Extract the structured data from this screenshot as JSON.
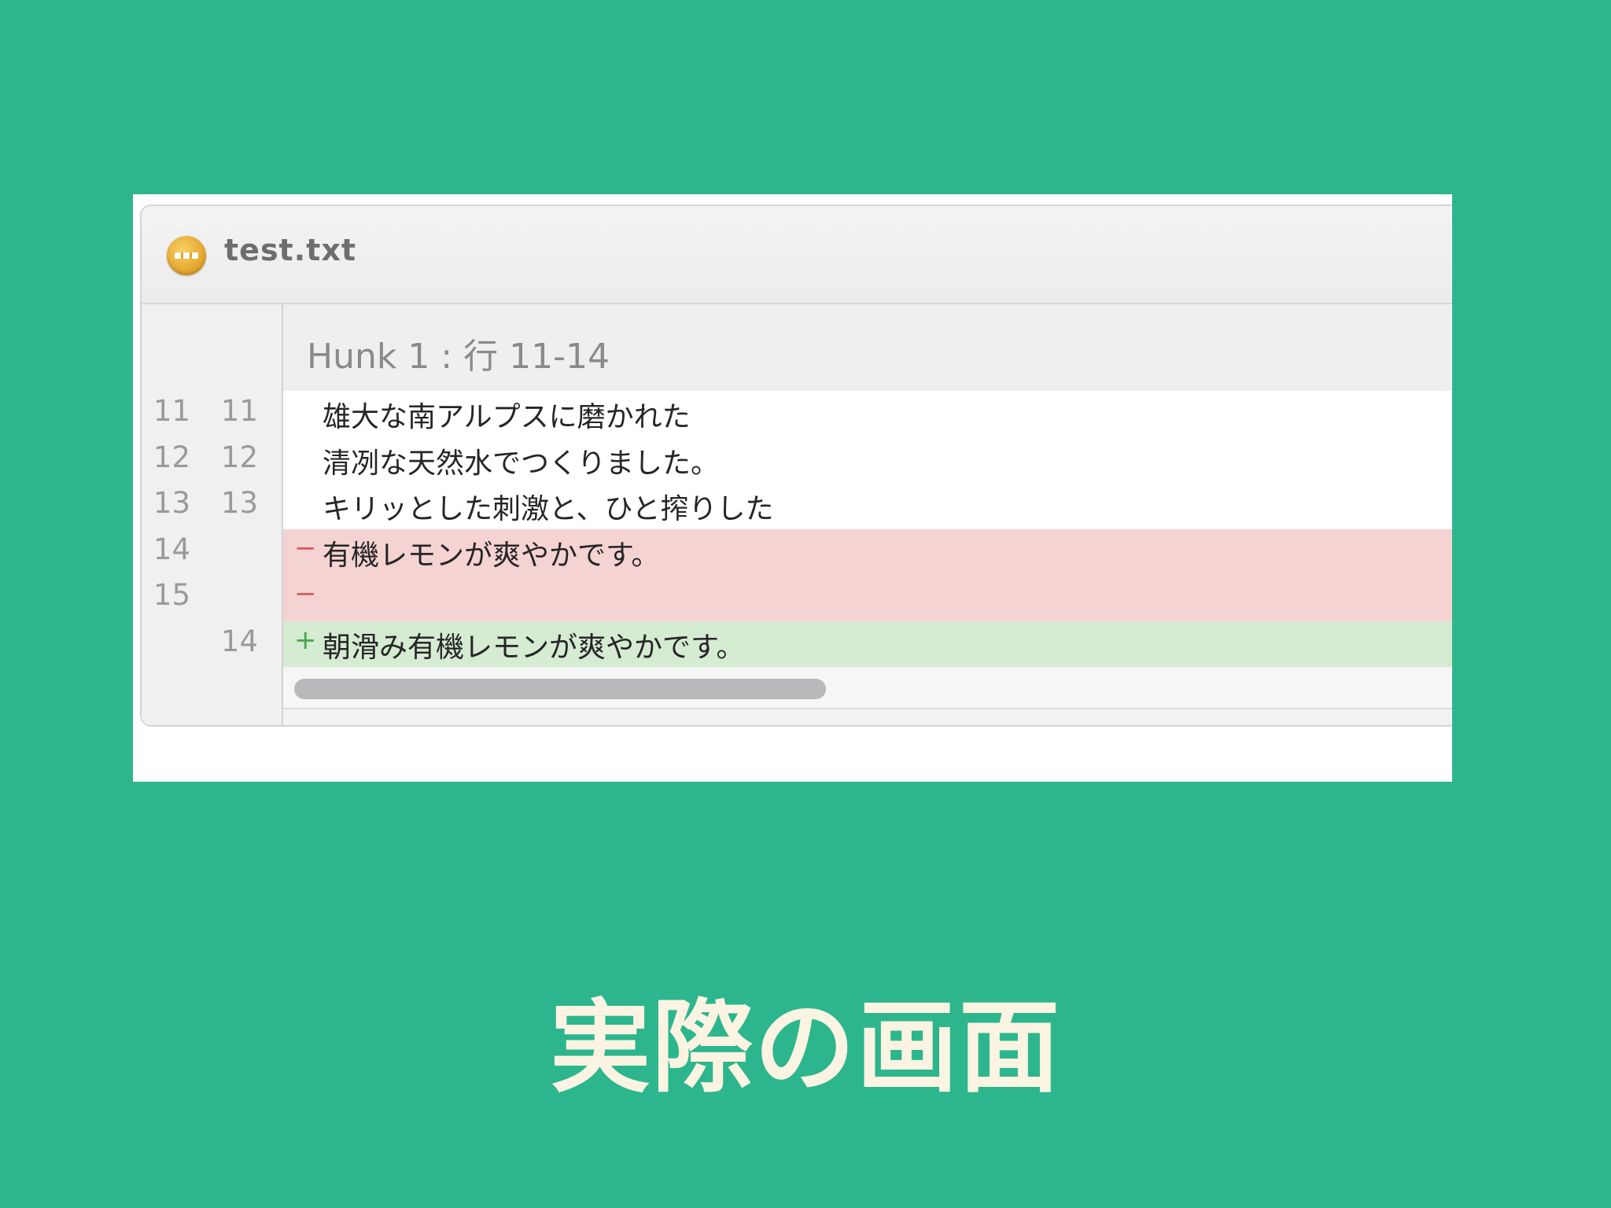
{
  "file": {
    "name": "test.txt",
    "status_icon": "ellipsis-circle-icon",
    "status_color": "#e3a22b"
  },
  "hunk": {
    "title": "Hunk 1 : 行 11-14"
  },
  "lines": [
    {
      "type": "context",
      "old": "11",
      "new": "11",
      "marker": "",
      "text": "雄大な南アルプスに磨かれた"
    },
    {
      "type": "context",
      "old": "12",
      "new": "12",
      "marker": "",
      "text": "清冽な天然水でつくりました。"
    },
    {
      "type": "context",
      "old": "13",
      "new": "13",
      "marker": "",
      "text": "キリッとした刺激と、ひと搾りした"
    },
    {
      "type": "removed",
      "old": "14",
      "new": "",
      "marker": "−",
      "text": "有機レモンが爽やかです。"
    },
    {
      "type": "removed",
      "old": "15",
      "new": "",
      "marker": "−",
      "text": ""
    },
    {
      "type": "added",
      "old": "",
      "new": "14",
      "marker": "+",
      "text": "朝滑み有機レモンが爽やかです。"
    }
  ],
  "caption": "実際の画面",
  "colors": {
    "background": "#2db68d",
    "removed": "#f5d3d3",
    "added": "#d5ebd2",
    "caption": "#fbf4e2"
  }
}
